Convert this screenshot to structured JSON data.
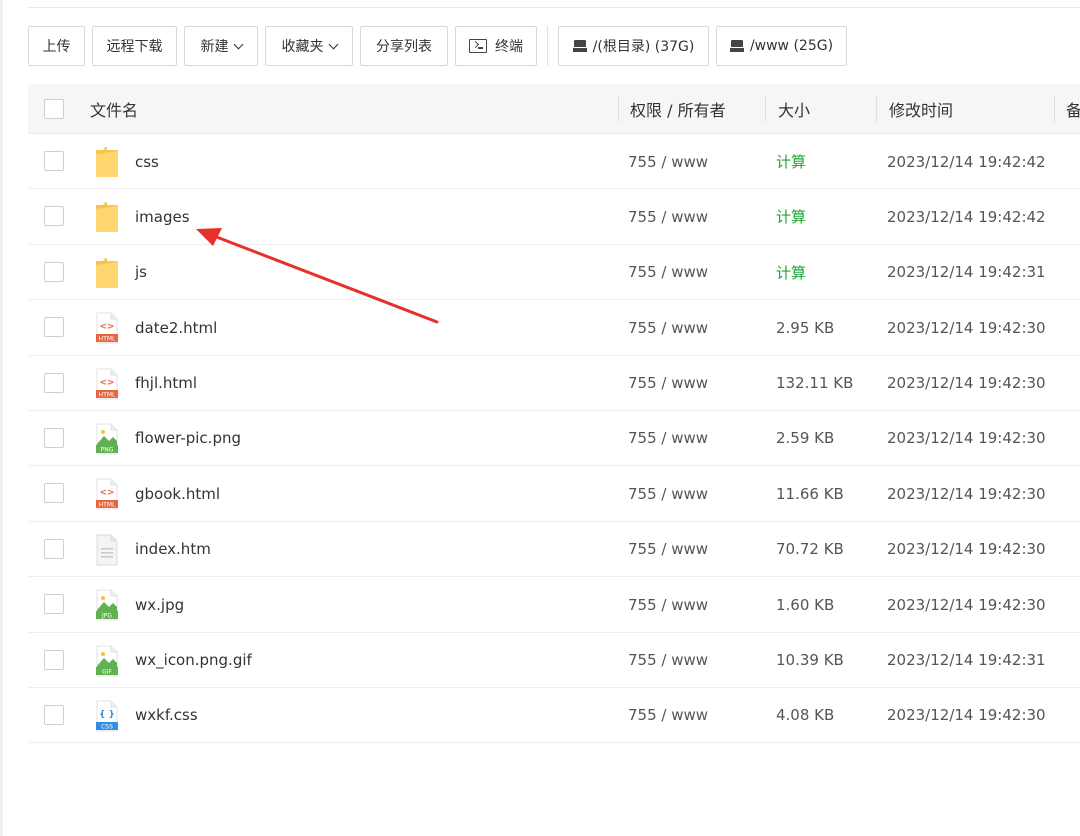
{
  "toolbar": {
    "upload": "上传",
    "remote_download": "远程下载",
    "new": "新建",
    "favorites": "收藏夹",
    "share_list": "分享列表",
    "terminal": "终端",
    "disk_root": "/(根目录) (37G)",
    "disk_www": "/www (25G)"
  },
  "table": {
    "headers": {
      "name": "文件名",
      "perm": "权限 / 所有者",
      "size": "大小",
      "mtime": "修改时间",
      "note": "备"
    },
    "rows": [
      {
        "name": "css",
        "type": "folder",
        "perm": "755 / www",
        "size": "计算",
        "time": "2023/12/14 19:42:42"
      },
      {
        "name": "images",
        "type": "folder",
        "perm": "755 / www",
        "size": "计算",
        "time": "2023/12/14 19:42:42"
      },
      {
        "name": "js",
        "type": "folder",
        "perm": "755 / www",
        "size": "计算",
        "time": "2023/12/14 19:42:31"
      },
      {
        "name": "date2.html",
        "type": "html",
        "perm": "755 / www",
        "size": "2.95 KB",
        "time": "2023/12/14 19:42:30"
      },
      {
        "name": "fhjl.html",
        "type": "html",
        "perm": "755 / www",
        "size": "132.11 KB",
        "time": "2023/12/14 19:42:30"
      },
      {
        "name": "flower-pic.png",
        "type": "png",
        "perm": "755 / www",
        "size": "2.59 KB",
        "time": "2023/12/14 19:42:30"
      },
      {
        "name": "gbook.html",
        "type": "html",
        "perm": "755 / www",
        "size": "11.66 KB",
        "time": "2023/12/14 19:42:30"
      },
      {
        "name": "index.htm",
        "type": "text",
        "perm": "755 / www",
        "size": "70.72 KB",
        "time": "2023/12/14 19:42:30"
      },
      {
        "name": "wx.jpg",
        "type": "jpg",
        "perm": "755 / www",
        "size": "1.60 KB",
        "time": "2023/12/14 19:42:30"
      },
      {
        "name": "wx_icon.png.gif",
        "type": "gif",
        "perm": "755 / www",
        "size": "10.39 KB",
        "time": "2023/12/14 19:42:31"
      },
      {
        "name": "wxkf.css",
        "type": "css",
        "perm": "755 / www",
        "size": "4.08 KB",
        "time": "2023/12/14 19:42:30"
      }
    ]
  },
  "icon_labels": {
    "html": "HTML",
    "png": "PNG",
    "jpg": "JPG",
    "gif": "GIF",
    "css": "CSS",
    "html_glyph": "<>",
    "css_glyph": "{ }"
  },
  "colors": {
    "folder": "#f5c451",
    "html": "#e8663d",
    "image": "#5fb24f",
    "css": "#2f8fe6",
    "calc": "#20a53a",
    "annotation_arrow": "#e8302a"
  }
}
